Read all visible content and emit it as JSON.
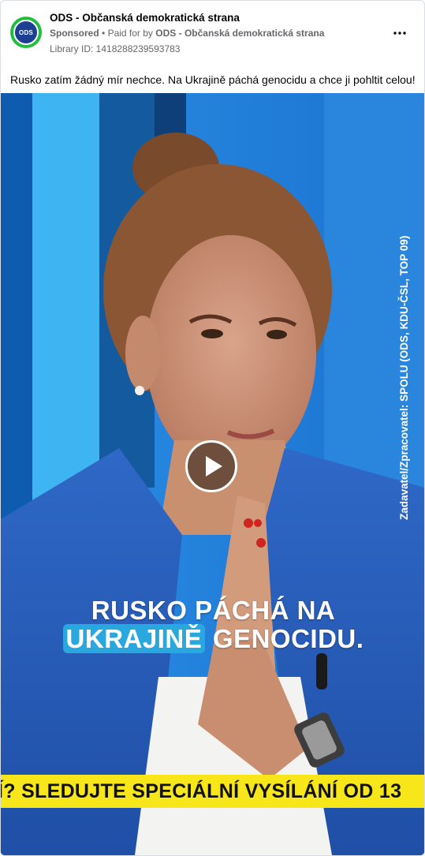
{
  "post": {
    "page_name": "ODS - Občanská demokratická strana",
    "sponsored": "Sponsored",
    "separator": "•",
    "paid_for_by_prefix": "Paid for by",
    "paid_for_by_name": "ODS - Občanská demokratická strana",
    "library_id": "Library ID: 1418288239593783",
    "avatar_text": "ODS",
    "ad_text": "Rusko zatím žádný mír nechce. Na Ukrajině páchá genocidu a chce ji pohltit celou!"
  },
  "video": {
    "side_text": "Zadavatel/Zpracovatel: SPOLU (ODS, KDU-ČSL, TOP 09)",
    "caption_line1": "RUSKO PÁCHÁ NA",
    "caption_highlight": "UKRAJINĚ",
    "caption_rest": " GENOCIDU.",
    "ticker": "Í? SLEDUJTE SPECIÁLNÍ VYSÍLÁNÍ OD 13"
  },
  "icons": {
    "more": "more-horizontal-icon",
    "play": "play-icon"
  },
  "colors": {
    "avatar_ring": "#1fbe3c",
    "avatar_fill": "#1c3f94",
    "studio_blue": "#1f7fd6",
    "caption_highlight": "#29a8e0",
    "ticker_bg": "#f6e61a",
    "secondary_text": "#65676b"
  }
}
